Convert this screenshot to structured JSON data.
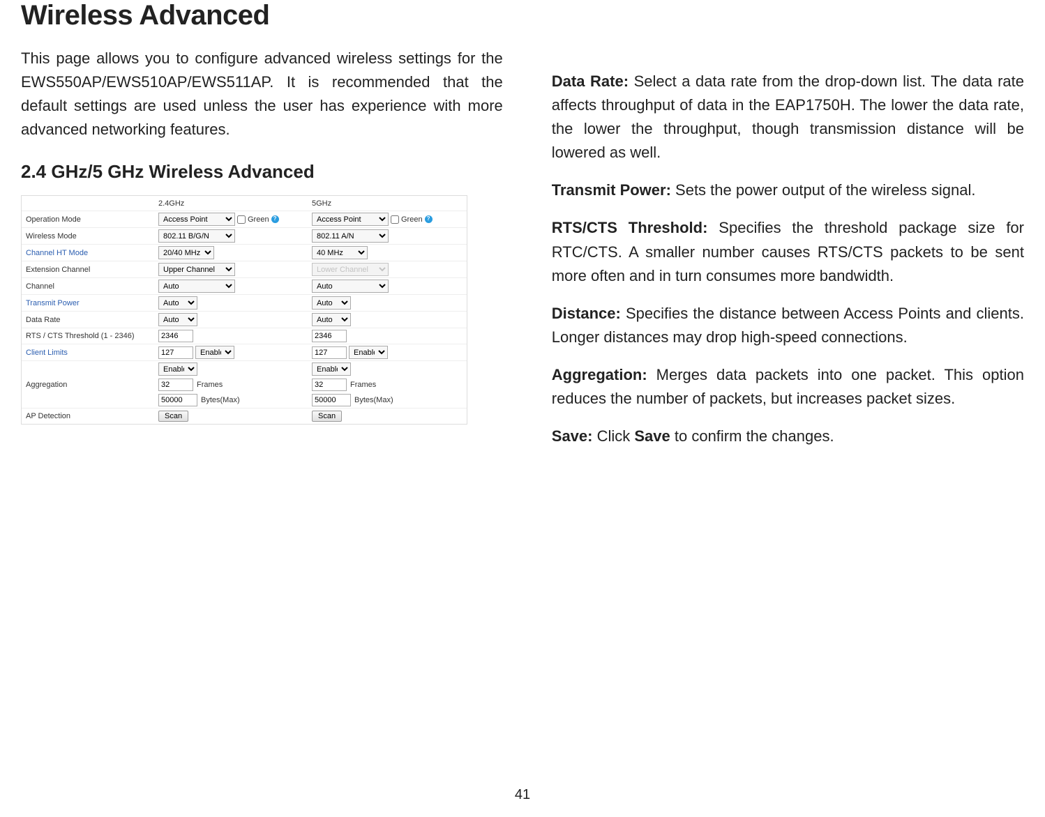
{
  "title": "Wireless Advanced",
  "intro": "This page allows you to configure advanced wireless settings for the EWS550AP/EWS510AP/EWS511AP. It is recommended that the default settings are used unless the user has experience with more advanced networking features.",
  "subheading": "2.4 GHz/5 GHz Wireless Advanced",
  "page_number": "41",
  "config": {
    "header": {
      "col1": "2.4GHz",
      "col2": "5GHz"
    },
    "labels": {
      "operation_mode": "Operation Mode",
      "wireless_mode": "Wireless Mode",
      "channel_ht": "Channel HT Mode",
      "extension_channel": "Extension Channel",
      "channel": "Channel",
      "transmit_power": "Transmit Power",
      "data_rate": "Data Rate",
      "rts": "RTS / CTS Threshold (1 - 2346)",
      "client_limits": "Client Limits",
      "aggregation": "Aggregation",
      "ap_detection": "AP Detection"
    },
    "green_label": "Green",
    "frames_label": "Frames",
    "bytes_label": "Bytes(Max)",
    "scan_label": "Scan",
    "enable_label": "Enable",
    "col24": {
      "operation_mode": "Access Point",
      "wireless_mode": "802.11 B/G/N",
      "channel_ht": "20/40 MHz",
      "extension_channel": "Upper Channel",
      "channel": "Auto",
      "transmit_power": "Auto",
      "data_rate": "Auto",
      "rts": "2346",
      "client_limits": "127",
      "agg_enable": "Enable",
      "agg_frames": "32",
      "agg_bytes": "50000"
    },
    "col5": {
      "operation_mode": "Access Point",
      "wireless_mode": "802.11 A/N",
      "channel_ht": "40 MHz",
      "extension_channel": "Lower Channel",
      "channel": "Auto",
      "transmit_power": "Auto",
      "data_rate": "Auto",
      "rts": "2346",
      "client_limits": "127",
      "agg_enable": "Enable",
      "agg_frames": "32",
      "agg_bytes": "50000"
    }
  },
  "right_col": {
    "data_rate_label": "Data Rate:",
    "data_rate_text": " Select a data rate from the drop-down list. The data rate affects throughput of data in the EAP1750H. The lower the data rate, the lower the throughput, though transmission distance will be lowered as well.",
    "transmit_power_label": "Transmit Power:",
    "transmit_power_text": " Sets the power output of the wireless signal.",
    "rts_label": "RTS/CTS Threshold:",
    "rts_text": " Specifies the threshold package size for RTC/CTS. A smaller number causes RTS/CTS packets to be sent more often and in turn consumes more bandwidth.",
    "distance_label": "Distance:",
    "distance_text": " Specifies the distance between Access Points and clients. Longer distances may drop high-speed connections.",
    "aggregation_label": "Aggregation:",
    "aggregation_text": " Merges data packets into one packet. This option reduces the number of packets, but increases packet sizes.",
    "save_label": "Save:",
    "save_mid": " Click ",
    "save_bold": "Save",
    "save_end": " to confirm the changes."
  }
}
